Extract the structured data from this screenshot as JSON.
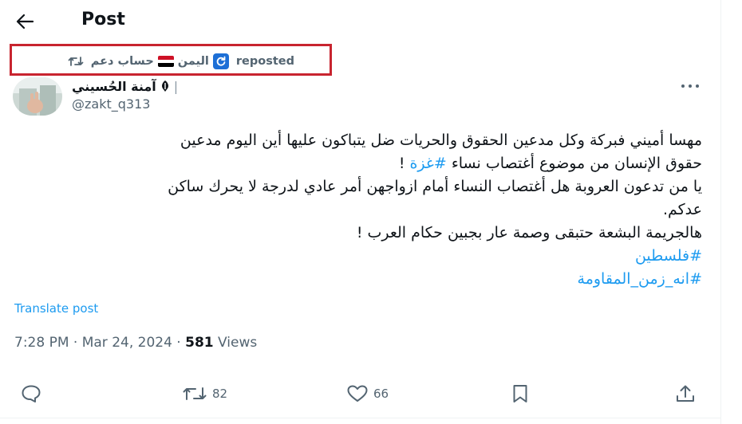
{
  "header": {
    "title": "Post"
  },
  "repost": {
    "account_name": "حساب دعم",
    "country": "اليمن",
    "label": "reposted"
  },
  "author": {
    "name": "آمنة الحُسيني",
    "name_suffix": "|",
    "handle": "@zakt_q313"
  },
  "tweet": {
    "lines": [
      "مهسا أميني فبركة  وكل مدعين الحقوق والحريات ضل يتباكون عليها أين اليوم مدعين",
      "يا من تدعون العروبة هل أغتصاب النساء أمام ازواجهن أمر عادي لدرجة لا يحرك ساكن",
      "عدكم.",
      "هالجريمة البشعة حتبقى وصمة عار بجبين حكام العرب !"
    ],
    "line2_text": "حقوق الإنسان من موضوع أغتصاب نساء",
    "line2_hashtag": "#غزة",
    "line2_end": " !",
    "hashtags": [
      "#فلسطين",
      "#انه_زمن_المقاومة"
    ]
  },
  "translate_label": "Translate post",
  "meta": {
    "time_date": "7:28 PM · Mar 24, 2024 · ",
    "views_count": "581",
    "views_label": " Views"
  },
  "actions": {
    "reply": "",
    "retweets": "82",
    "likes": "66"
  },
  "colors": {
    "accent": "#1d9bf0",
    "secondary_text": "#536471",
    "highlight_border": "#c8242f"
  }
}
